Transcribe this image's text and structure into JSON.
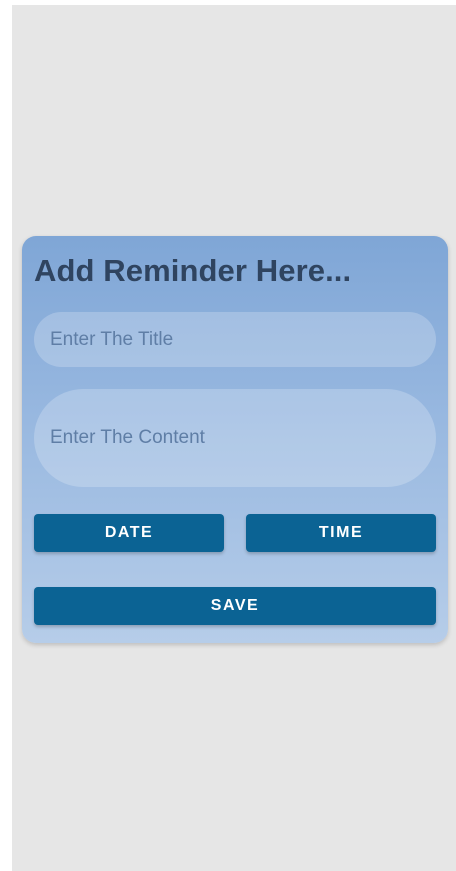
{
  "dialog": {
    "title": "Add Reminder Here...",
    "title_input": {
      "placeholder": "Enter The Title",
      "value": ""
    },
    "content_input": {
      "placeholder": "Enter The Content",
      "value": ""
    },
    "date_button_label": "DATE",
    "time_button_label": "TIME",
    "save_button_label": "SAVE"
  },
  "colors": {
    "screen_background": "#e6e6e6",
    "card_gradient_top": "#7fa6d6",
    "card_gradient_bottom": "#b6cde9",
    "title_text": "#2f4460",
    "button": "#0b6394",
    "button_text": "#ffffff"
  }
}
